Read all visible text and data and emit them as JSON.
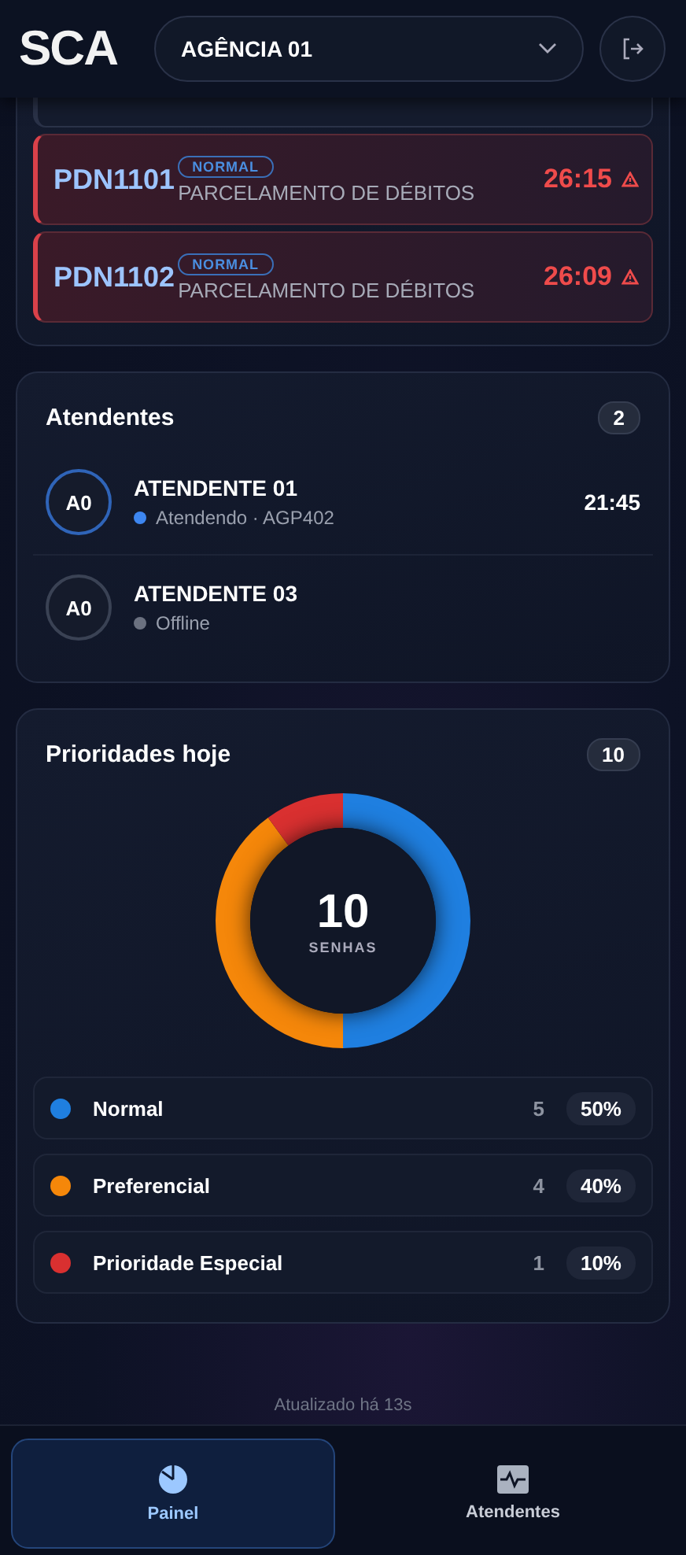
{
  "header": {
    "logo": "SCA",
    "agency": "AGÊNCIA 01"
  },
  "tickets": [
    {
      "code": "PDN1101",
      "priority": "NORMAL",
      "service": "PARCELAMENTO DE DÉBITOS",
      "wait": "26:15",
      "overdue": true
    },
    {
      "code": "PDN1102",
      "priority": "NORMAL",
      "service": "PARCELAMENTO DE DÉBITOS",
      "wait": "26:09",
      "overdue": true
    }
  ],
  "attendants": {
    "title": "Atendentes",
    "count": "2",
    "items": [
      {
        "initials": "A0",
        "name": "ATENDENTE 01",
        "status": "Atendendo · AGP402",
        "online": true,
        "time": "21:45"
      },
      {
        "initials": "A0",
        "name": "ATENDENTE 03",
        "status": "Offline",
        "online": false
      }
    ]
  },
  "priorities": {
    "title": "Prioridades hoje",
    "count": "10",
    "total": "10",
    "total_label": "SENHAS",
    "chart_data": {
      "type": "donut",
      "categories": [
        "Normal",
        "Preferencial",
        "Prioridade Especial"
      ],
      "values": [
        50,
        40,
        10
      ]
    },
    "items": [
      {
        "count": "5",
        "percent": "50%",
        "color": "#1f7fe0"
      },
      {
        "count": "4",
        "percent": "40%",
        "color": "#f5870a"
      },
      {
        "count": "1",
        "percent": "10%",
        "color": "#d93030"
      }
    ]
  },
  "updated": "Atualizado há 13s",
  "nav": [
    {
      "label": "Painel",
      "kind": "chart",
      "selected": true
    },
    {
      "label": "Atendentes",
      "kind": "activity",
      "selected": false
    }
  ]
}
